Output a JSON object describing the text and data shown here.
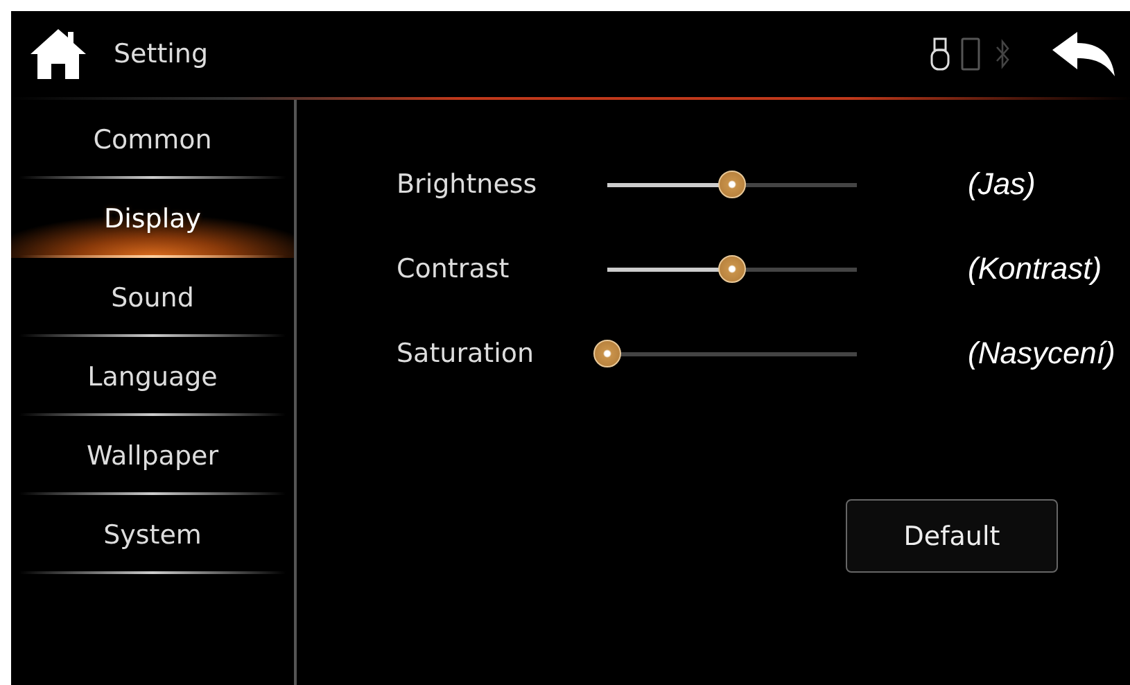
{
  "header": {
    "title": "Setting"
  },
  "sidebar": {
    "items": [
      {
        "label": "Common",
        "selected": false
      },
      {
        "label": "Display",
        "selected": true
      },
      {
        "label": "Sound",
        "selected": false
      },
      {
        "label": "Language",
        "selected": false
      },
      {
        "label": "Wallpaper",
        "selected": false
      },
      {
        "label": "System",
        "selected": false
      }
    ]
  },
  "settings": [
    {
      "label": "Brightness",
      "level": 0.5,
      "note": "(Jas)"
    },
    {
      "label": "Contrast",
      "level": 0.5,
      "note": "(Kontrast)"
    },
    {
      "label": "Saturation",
      "level": 0,
      "note": "(Nasycení)"
    }
  ],
  "buttons": [
    "Default"
  ]
}
